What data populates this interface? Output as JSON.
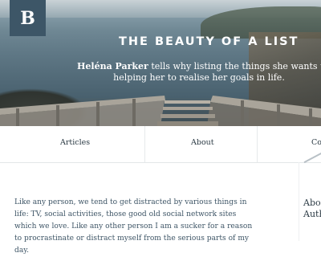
{
  "logo": {
    "letter": "B"
  },
  "hero": {
    "title": "THE BEAUTY OF A LIST",
    "author": "Heléna Parker",
    "subtitle_line1_rest": "tells why listing the things she wants to do is",
    "subtitle_line2": "helping her to realise her goals in life."
  },
  "nav": {
    "items": [
      {
        "label": "Articles"
      },
      {
        "label": "About"
      },
      {
        "label": "Co"
      }
    ]
  },
  "article": {
    "text": "Like any person, we tend to get distracted by various things in life: TV, social activities, those good old social network sites which we love. Like any other person I am a sucker for a reason to procrastinate or distract myself from the serious parts of my day."
  },
  "aside": {
    "line1": "Abo",
    "line2": "Auth"
  }
}
